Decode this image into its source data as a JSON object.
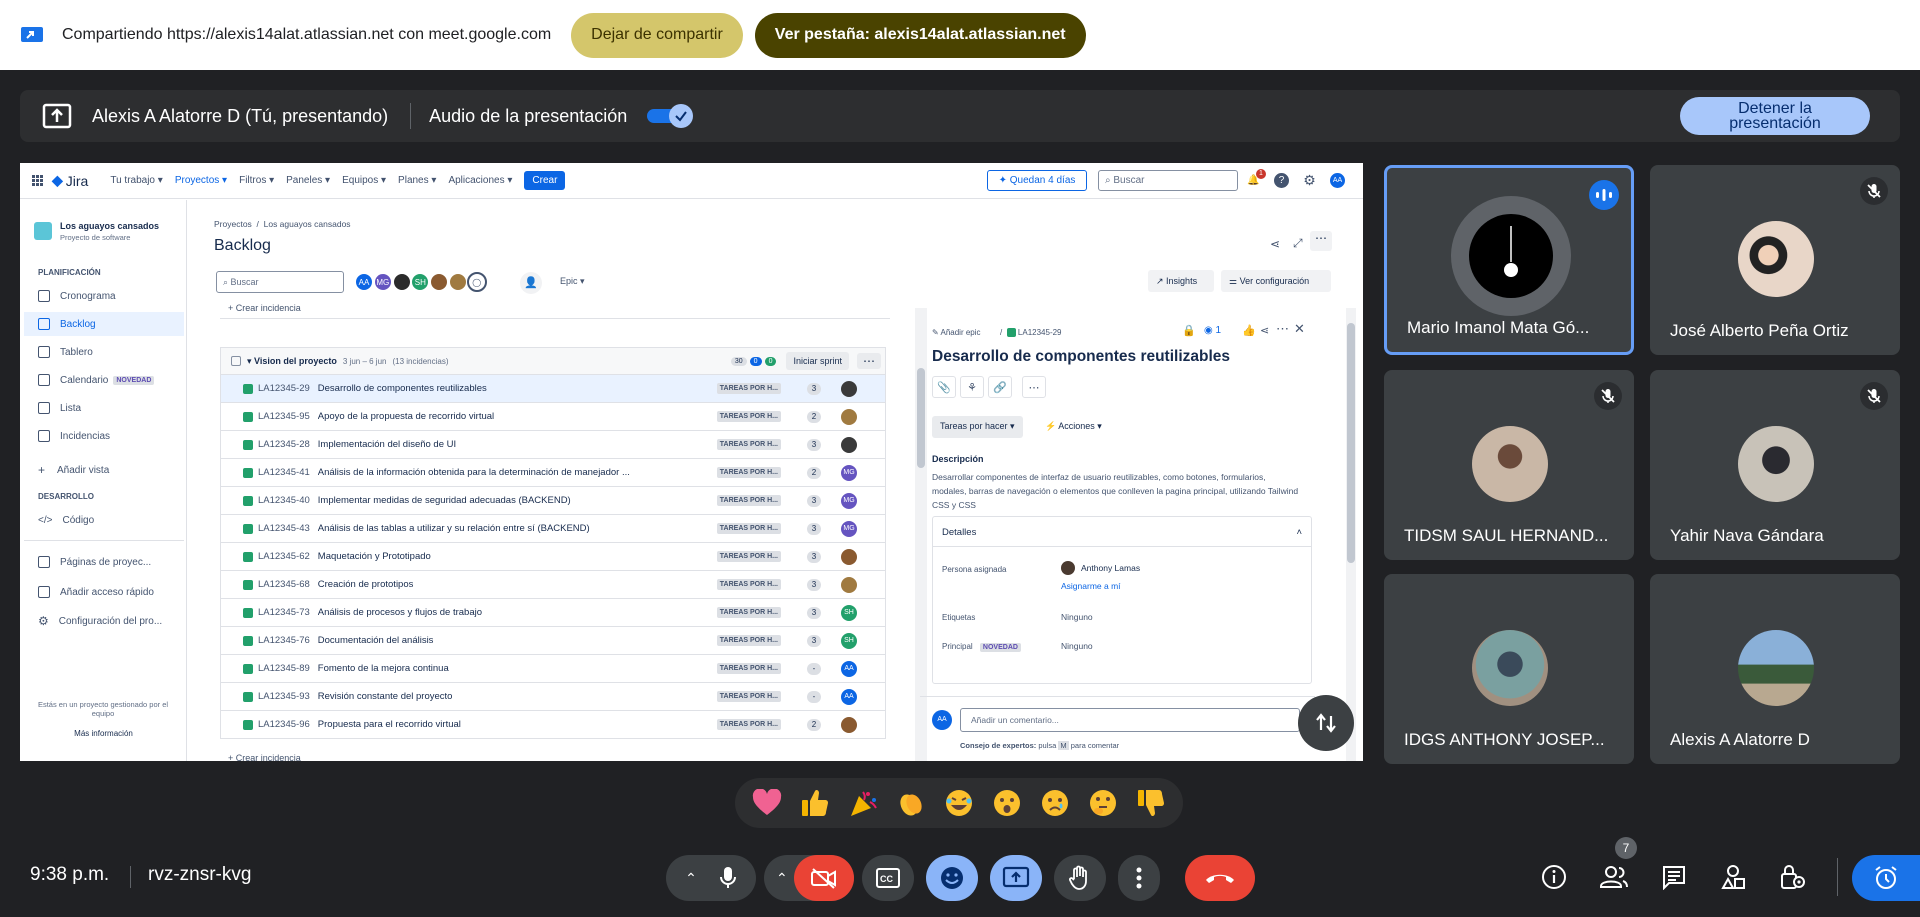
{
  "share_bar": {
    "text": "Compartiendo https://alexis14alat.atlassian.net con meet.google.com",
    "stop_sharing": "Dejar de compartir",
    "view_tab": "Ver pestaña: alexis14alat.atlassian.net"
  },
  "presenting_bar": {
    "presenter": "Alexis A Alatorre D (Tú, presentando)",
    "audio_label": "Audio de la presentación",
    "audio_on": true,
    "stop_line1": "Detener la",
    "stop_line2": "presentación"
  },
  "jira": {
    "logo": "Jira",
    "nav": [
      "Tu trabajo",
      "Proyectos",
      "Filtros",
      "Paneles",
      "Equipos",
      "Planes",
      "Aplicaciones"
    ],
    "create": "Crear",
    "trial": "Quedan 4 días",
    "search_placeholder": "Buscar",
    "notif_count": "1",
    "sidebar": {
      "project_name": "Los aguayos cansados",
      "project_type": "Proyecto de software",
      "section_planning": "PLANIFICACIÓN",
      "items": [
        "Cronograma",
        "Backlog",
        "Tablero",
        "Calendario",
        "Lista",
        "Incidencias",
        "Añadir vista"
      ],
      "new_badge": "NOVEDAD",
      "section_dev": "DESARROLLO",
      "dev_item": "Código",
      "bottom_items": [
        "Páginas de proyec...",
        "Añadir acceso rápido",
        "Configuración del pro..."
      ],
      "footer": "Estás en un proyecto gestionado por el equipo",
      "more_info": "Más información"
    },
    "breadcrumb": [
      "Proyectos",
      "Los aguayos cansados"
    ],
    "page_title": "Backlog",
    "backlog_search": "Buscar",
    "avatars": [
      "AA",
      "MG",
      "SH"
    ],
    "epic_filter": "Epic",
    "insights": "Insights",
    "ver_config": "Ver configuración",
    "crear_incidencia": "+ Crear incidencia",
    "sprint": {
      "name": "Vision del proyecto",
      "dates": "3 jun – 6 jun",
      "count": "(13 incidencias)",
      "points": [
        "30",
        "0",
        "0"
      ],
      "start": "Iniciar sprint"
    },
    "issues": [
      {
        "key": "LA12345-29",
        "summary": "Desarrollo de componentes reutilizables",
        "status": "TAREAS POR H...",
        "points": "3",
        "assignee": ""
      },
      {
        "key": "LA12345-95",
        "summary": "Apoyo de la propuesta de recorrido virtual",
        "status": "TAREAS POR H...",
        "points": "2",
        "assignee": ""
      },
      {
        "key": "LA12345-28",
        "summary": "Implementación del diseño de UI",
        "status": "TAREAS POR H...",
        "points": "3",
        "assignee": ""
      },
      {
        "key": "LA12345-41",
        "summary": "Análisis de la información obtenida para la determinación de manejador ...",
        "status": "TAREAS POR H...",
        "points": "2",
        "assignee": "MG"
      },
      {
        "key": "LA12345-40",
        "summary": "Implementar medidas de seguridad adecuadas (BACKEND)",
        "status": "TAREAS POR H...",
        "points": "3",
        "assignee": "MG"
      },
      {
        "key": "LA12345-43",
        "summary": "Análisis de las tablas a utilizar y su relación entre sí (BACKEND)",
        "status": "TAREAS POR H...",
        "points": "3",
        "assignee": "MG"
      },
      {
        "key": "LA12345-62",
        "summary": "Maquetación y Prototipado",
        "status": "TAREAS POR H...",
        "points": "3",
        "assignee": ""
      },
      {
        "key": "LA12345-68",
        "summary": "Creación de prototipos",
        "status": "TAREAS POR H...",
        "points": "3",
        "assignee": ""
      },
      {
        "key": "LA12345-73",
        "summary": "Análisis de procesos y flujos de trabajo",
        "status": "TAREAS POR H...",
        "points": "3",
        "assignee": "SH"
      },
      {
        "key": "LA12345-76",
        "summary": "Documentación del análisis",
        "status": "TAREAS POR H...",
        "points": "3",
        "assignee": "SH"
      },
      {
        "key": "LA12345-89",
        "summary": "Fomento de la mejora continua",
        "status": "TAREAS POR H...",
        "points": "-",
        "assignee": "AA"
      },
      {
        "key": "LA12345-93",
        "summary": "Revisión constante del proyecto",
        "status": "TAREAS POR H...",
        "points": "-",
        "assignee": "AA"
      },
      {
        "key": "LA12345-96",
        "summary": "Propuesta para el recorrido virtual",
        "status": "TAREAS POR H...",
        "points": "2",
        "assignee": ""
      }
    ],
    "detail": {
      "add_epic": "Añadir epic",
      "key": "LA12345-29",
      "watchers": "1",
      "title": "Desarrollo de componentes reutilizables",
      "status": "Tareas por hacer",
      "actions": "Acciones",
      "desc_label": "Descripción",
      "description": "Desarrollar componentes de interfaz de usuario reutilizables, como botones, formularios, modales, barras de navegación o elementos que conlleven la pagina principal, utilizando Tailwind CSS y CSS",
      "details_label": "Detalles",
      "assignee_label": "Persona asignada",
      "assignee": "Anthony Lamas",
      "assign_me": "Asignarme a mí",
      "labels_label": "Etiquetas",
      "labels_value": "Ninguno",
      "principal_label": "Principal",
      "principal_badge": "NOVEDAD",
      "principal_value": "Ninguno",
      "comment_avatar": "AA",
      "comment_placeholder": "Añadir un comentario...",
      "tip_prefix": "Consejo de expertos:",
      "tip_rest": "pulsa",
      "tip_key": "M",
      "tip_suffix": "para comentar"
    }
  },
  "participants": [
    {
      "name": "Mario Imanol Mata Gó...",
      "speaking": true
    },
    {
      "name": "José Alberto Peña Ortiz",
      "muted": true
    },
    {
      "name": "TIDSM SAUL HERNAND...",
      "muted": true
    },
    {
      "name": "Yahir Nava Gándara",
      "muted": true
    },
    {
      "name": "IDGS ANTHONY JOSEP..."
    },
    {
      "name": "Alexis A Alatorre D"
    }
  ],
  "reactions": [
    "💖",
    "👍",
    "🎉",
    "👏",
    "😂",
    "😮",
    "😢",
    "🤔",
    "👎"
  ],
  "bottom": {
    "time": "9:38 p.m.",
    "meeting_code": "rvz-znsr-kvg",
    "people_count": "7"
  },
  "colors": {
    "accent": "#1a73e8",
    "hangup": "#ea4335",
    "jira_blue": "#0c66e4"
  }
}
